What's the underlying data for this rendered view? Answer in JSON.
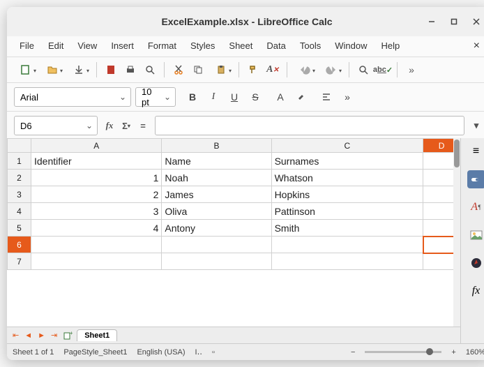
{
  "title": "ExcelExample.xlsx - LibreOffice Calc",
  "menu": [
    "File",
    "Edit",
    "View",
    "Insert",
    "Format",
    "Styles",
    "Sheet",
    "Data",
    "Tools",
    "Window",
    "Help"
  ],
  "toolbar2": {
    "font": "Arial",
    "size": "10 pt"
  },
  "formula_bar": {
    "cell_ref": "D6",
    "formula": ""
  },
  "columns": [
    "A",
    "B",
    "C",
    "D"
  ],
  "active_col_index": 3,
  "active_row_index": 5,
  "rows": [
    {
      "num": "1",
      "A": "Identifier",
      "B": "Name",
      "C": "Surnames",
      "D": ""
    },
    {
      "num": "2",
      "A": "1",
      "B": "Noah",
      "C": "Whatson",
      "D": ""
    },
    {
      "num": "3",
      "A": "2",
      "B": "James",
      "C": "Hopkins",
      "D": ""
    },
    {
      "num": "4",
      "A": "3",
      "B": "Oliva",
      "C": "Pattinson",
      "D": ""
    },
    {
      "num": "5",
      "A": "4",
      "B": "Antony",
      "C": "Smith",
      "D": ""
    },
    {
      "num": "6",
      "A": "",
      "B": "",
      "C": "",
      "D": ""
    },
    {
      "num": "7",
      "A": "",
      "B": "",
      "C": "",
      "D": ""
    }
  ],
  "tabs": {
    "sheet": "Sheet1"
  },
  "status": {
    "sheet_counter": "Sheet 1 of 1",
    "pagestyle": "PageStyle_Sheet1",
    "lang": "English (USA)",
    "zoom": "160%"
  }
}
